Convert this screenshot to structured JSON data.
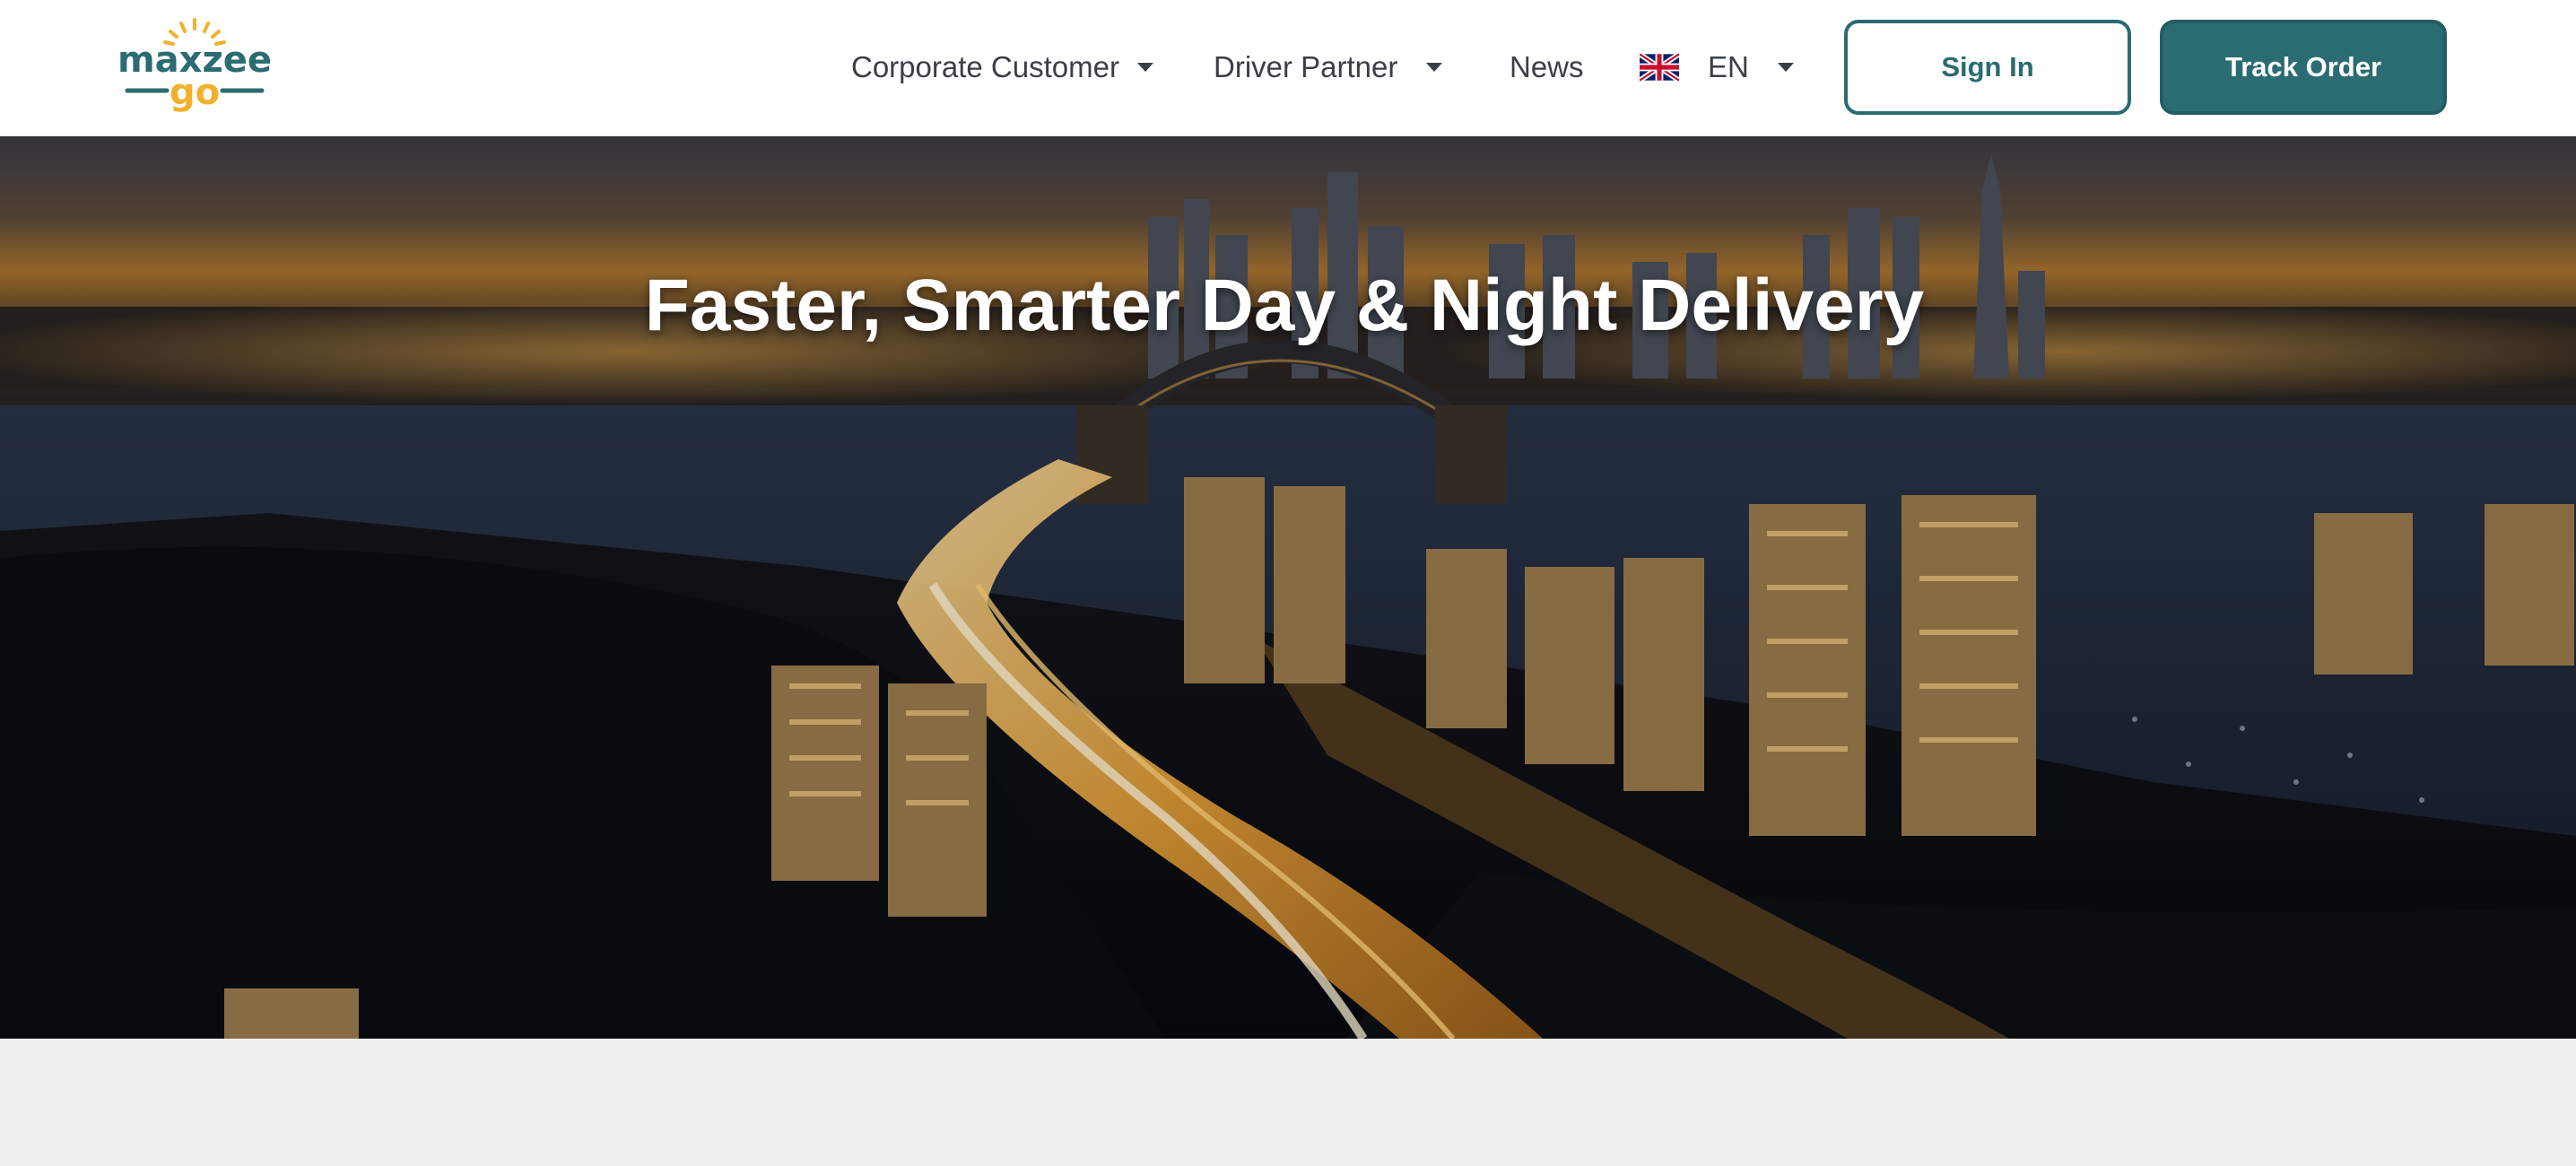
{
  "brand": {
    "logo_top": "maxzee",
    "logo_bottom": "go",
    "primary_color": "#2b6b72",
    "accent_color": "#f3b12b"
  },
  "nav": {
    "corporate_customer": "Corporate Customer",
    "driver_partner": "Driver Partner",
    "news": "News",
    "language": "EN",
    "language_flag_icon": "uk-flag-icon"
  },
  "actions": {
    "sign_in": "Sign In",
    "track_order": "Track Order"
  },
  "hero": {
    "title": "Faster, Smarter Day & Night Delivery",
    "background_image": "night city skyline with harbour bridge and light-trailed highway"
  }
}
